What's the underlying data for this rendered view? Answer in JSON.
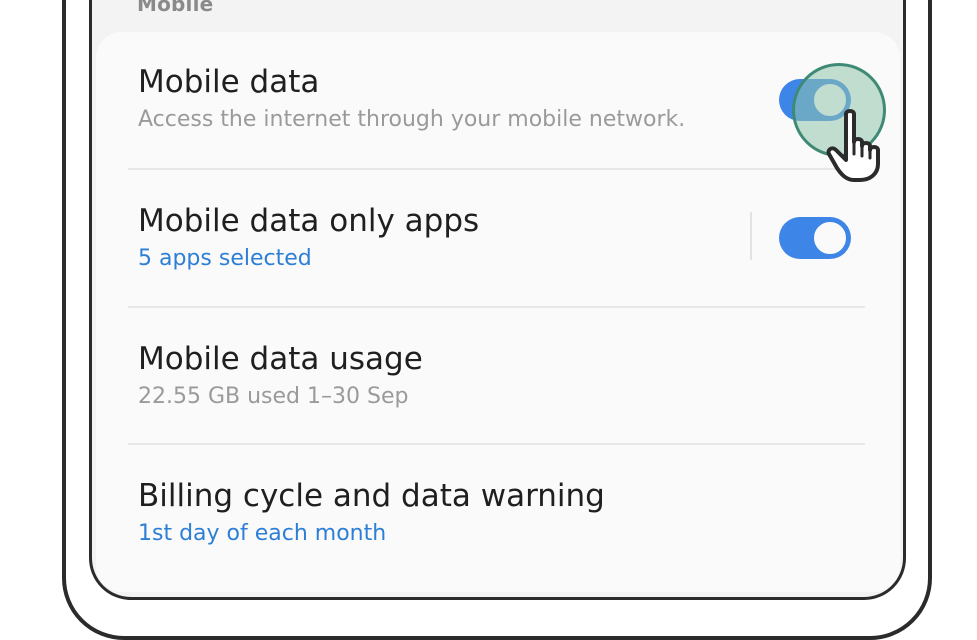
{
  "section": {
    "title": "Mobile"
  },
  "rows": [
    {
      "title": "Mobile data",
      "subtitle": "Access the internet through your mobile network.",
      "toggle_on": true
    },
    {
      "title": "Mobile data only apps",
      "subtitle": "5 apps selected",
      "toggle_on": true
    },
    {
      "title": "Mobile data usage",
      "subtitle": "22.55 GB used 1–30 Sep"
    },
    {
      "title": "Billing cycle and data warning",
      "subtitle": "1st day of each month"
    }
  ],
  "colors": {
    "accent": "#3e85e8",
    "link_blue": "#2d7fd6",
    "tap_highlight": "#8fc4ac"
  },
  "icons": {
    "cursor": "pointing-hand-icon"
  }
}
